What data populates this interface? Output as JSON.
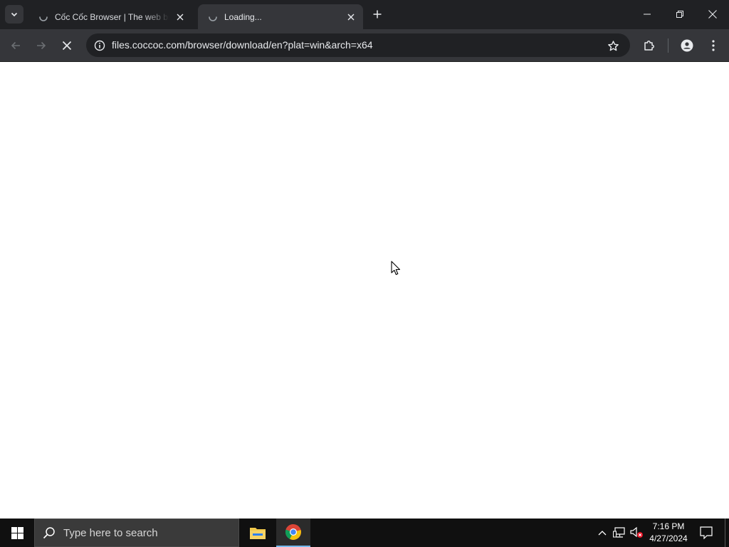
{
  "browser": {
    "tabs": [
      {
        "title": "Cốc Cốc Browser | The web bro",
        "state": "loading"
      },
      {
        "title": "Loading...",
        "state": "loading",
        "active": true
      }
    ],
    "address_bar": {
      "url": "files.coccoc.com/browser/download/en?plat=win&arch=x64"
    },
    "icons": {
      "tab_search": "chevron-down-icon",
      "new_tab": "plus-icon",
      "back": "arrow-left-icon",
      "forward": "arrow-right-icon",
      "stop": "close-icon",
      "site_info": "info-icon",
      "bookmark": "star-icon",
      "extensions": "puzzle-icon",
      "profile": "person-icon",
      "menu": "kebab-menu-icon"
    }
  },
  "taskbar": {
    "search_placeholder": "Type here to search",
    "apps": [
      "file-explorer-icon",
      "chrome-icon"
    ],
    "tray": {
      "time": "7:16 PM",
      "date": "4/27/2024"
    }
  },
  "colors": {
    "titlebar": "#202124",
    "toolbar": "#35363a",
    "omnibox": "#202124",
    "taskbar": "#101010",
    "active_app_underline": "#76b9ed"
  }
}
